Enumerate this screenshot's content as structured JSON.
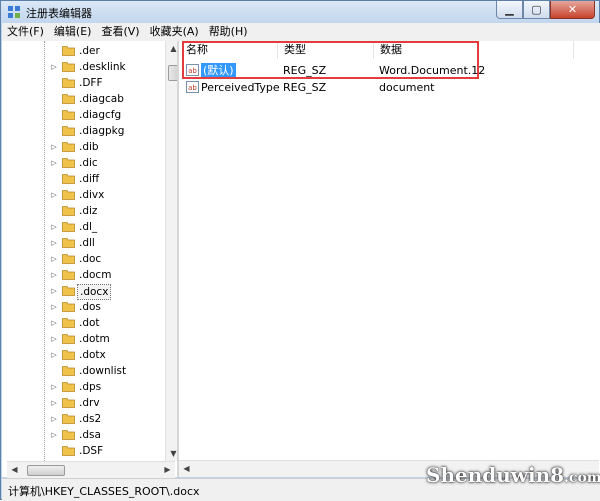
{
  "window": {
    "title": "注册表编辑器"
  },
  "menu": [
    "文件(F)",
    "编辑(E)",
    "查看(V)",
    "收藏夹(A)",
    "帮助(H)"
  ],
  "tree": {
    "items": [
      {
        "label": ".der",
        "expandable": false
      },
      {
        "label": ".desklink",
        "expandable": true
      },
      {
        "label": ".DFF",
        "expandable": false
      },
      {
        "label": ".diagcab",
        "expandable": false
      },
      {
        "label": ".diagcfg",
        "expandable": false
      },
      {
        "label": ".diagpkg",
        "expandable": false
      },
      {
        "label": ".dib",
        "expandable": true
      },
      {
        "label": ".dic",
        "expandable": true
      },
      {
        "label": ".diff",
        "expandable": false
      },
      {
        "label": ".divx",
        "expandable": true
      },
      {
        "label": ".diz",
        "expandable": false
      },
      {
        "label": ".dl_",
        "expandable": true
      },
      {
        "label": ".dll",
        "expandable": true
      },
      {
        "label": ".doc",
        "expandable": true
      },
      {
        "label": ".docm",
        "expandable": true
      },
      {
        "label": ".docx",
        "expandable": true,
        "selected": true
      },
      {
        "label": ".dos",
        "expandable": true
      },
      {
        "label": ".dot",
        "expandable": true
      },
      {
        "label": ".dotm",
        "expandable": true
      },
      {
        "label": ".dotx",
        "expandable": true
      },
      {
        "label": ".downlist",
        "expandable": false
      },
      {
        "label": ".dps",
        "expandable": true
      },
      {
        "label": ".drv",
        "expandable": true
      },
      {
        "label": ".ds2",
        "expandable": true
      },
      {
        "label": ".dsa",
        "expandable": true
      },
      {
        "label": ".DSF",
        "expandable": false
      }
    ]
  },
  "values": {
    "columns": {
      "name": "名称",
      "type": "类型",
      "data": "数据"
    },
    "rows": [
      {
        "icon": "string-value-icon",
        "name": "(默认)",
        "type": "REG_SZ",
        "data": "Word.Document.12",
        "selected": true
      },
      {
        "icon": "string-value-icon",
        "name": "PerceivedType",
        "type": "REG_SZ",
        "data": "document",
        "selected": false
      }
    ]
  },
  "status": {
    "path": "计算机\\HKEY_CLASSES_ROOT\\.docx"
  },
  "watermark": {
    "brand": "Shenduwin8",
    "domain": ".com"
  },
  "colors": {
    "highlight": "#e23c3c",
    "selection": "#3399ff",
    "folder": "#f0c24b"
  }
}
